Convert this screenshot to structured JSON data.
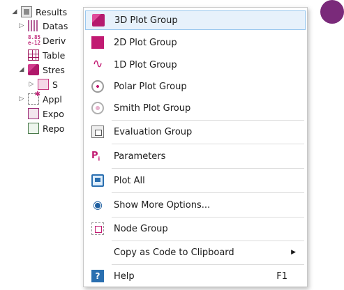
{
  "tree": {
    "results": "Results",
    "datasets": "Datas",
    "derived": "Deriv",
    "derived_icon_text": "8.85\ne-12",
    "table": "Table",
    "stress": "Stres",
    "surface": "S",
    "applications": "Appl",
    "export": "Expo",
    "reports": "Repo"
  },
  "menu": {
    "plot3d": "3D Plot Group",
    "plot2d": "2D Plot Group",
    "plot1d": "1D Plot Group",
    "polar": "Polar Plot Group",
    "smith": "Smith Plot Group",
    "evaluation": "Evaluation Group",
    "parameters": "Parameters",
    "plot_all": "Plot All",
    "show_more": "Show More Options...",
    "node_group": "Node Group",
    "copy_code": "Copy as Code to Clipboard",
    "help": "Help",
    "help_shortcut": "F1"
  },
  "icons": {
    "plot3d": "3d-plot-group-icon",
    "plot2d": "2d-plot-group-icon",
    "plot1d": "1d-plot-group-icon",
    "polar": "polar-plot-icon",
    "smith": "smith-plot-icon",
    "evaluation": "evaluation-group-icon",
    "parameters": "parameters-icon",
    "plot_all": "plot-all-icon",
    "show_more": "eye-icon",
    "node_group": "node-group-icon",
    "help": "help-icon"
  },
  "colors": {
    "accent": "#c11a72",
    "highlight": "#e7f1fb",
    "highlight_border": "#99c7ee"
  }
}
